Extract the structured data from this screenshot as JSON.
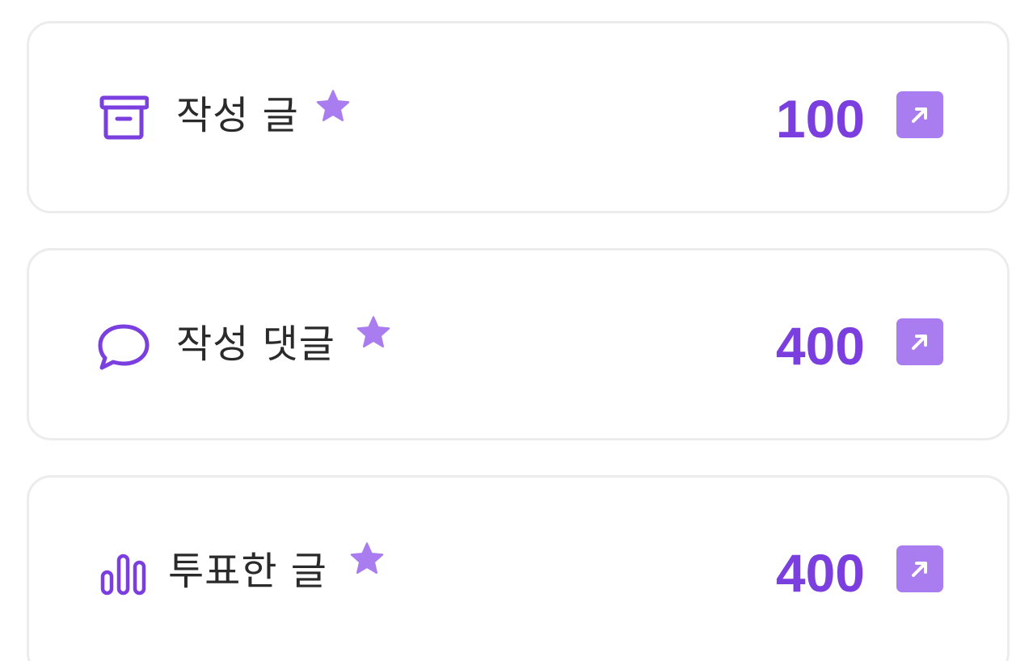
{
  "colors": {
    "accent": "#7b3fe0",
    "accent_light": "#a97df0",
    "border": "#ececec",
    "text": "#2a2a2a"
  },
  "stats": [
    {
      "icon": "archive-box-icon",
      "label": "작성 글",
      "value": "100",
      "starred": true,
      "action_icon": "arrow-up-right-icon"
    },
    {
      "icon": "chat-bubble-icon",
      "label": "작성 댓글",
      "value": "400",
      "starred": true,
      "action_icon": "arrow-up-right-icon"
    },
    {
      "icon": "bar-chart-icon",
      "label": "투표한 글",
      "value": "400",
      "starred": true,
      "action_icon": "arrow-up-right-icon"
    }
  ]
}
